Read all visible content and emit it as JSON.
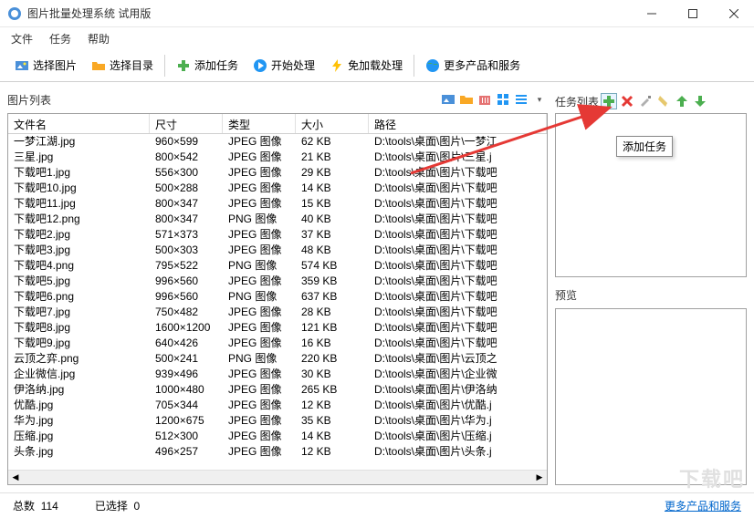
{
  "window": {
    "title": "图片批量处理系统 试用版"
  },
  "menu": {
    "file": "文件",
    "task": "任务",
    "help": "帮助"
  },
  "toolbar": {
    "select_image": "选择图片",
    "select_dir": "选择目录",
    "add_task": "添加任务",
    "start": "开始处理",
    "free_load": "免加载处理",
    "more": "更多产品和服务"
  },
  "left": {
    "title": "图片列表",
    "columns": {
      "name": "文件名",
      "dim": "尺寸",
      "type": "类型",
      "size": "大小",
      "path": "路径"
    },
    "rows": [
      {
        "name": "一梦江湖.jpg",
        "dim": "960×599",
        "type": "JPEG 图像",
        "size": "62 KB",
        "path": "D:\\tools\\桌面\\图片\\一梦江"
      },
      {
        "name": "三星.jpg",
        "dim": "800×542",
        "type": "JPEG 图像",
        "size": "21 KB",
        "path": "D:\\tools\\桌面\\图片\\三星.j"
      },
      {
        "name": "下载吧1.jpg",
        "dim": "556×300",
        "type": "JPEG 图像",
        "size": "29 KB",
        "path": "D:\\tools\\桌面\\图片\\下载吧"
      },
      {
        "name": "下载吧10.jpg",
        "dim": "500×288",
        "type": "JPEG 图像",
        "size": "14 KB",
        "path": "D:\\tools\\桌面\\图片\\下载吧"
      },
      {
        "name": "下载吧11.jpg",
        "dim": "800×347",
        "type": "JPEG 图像",
        "size": "15 KB",
        "path": "D:\\tools\\桌面\\图片\\下载吧"
      },
      {
        "name": "下载吧12.png",
        "dim": "800×347",
        "type": "PNG 图像",
        "size": "40 KB",
        "path": "D:\\tools\\桌面\\图片\\下载吧"
      },
      {
        "name": "下载吧2.jpg",
        "dim": "571×373",
        "type": "JPEG 图像",
        "size": "37 KB",
        "path": "D:\\tools\\桌面\\图片\\下载吧"
      },
      {
        "name": "下载吧3.jpg",
        "dim": "500×303",
        "type": "JPEG 图像",
        "size": "48 KB",
        "path": "D:\\tools\\桌面\\图片\\下载吧"
      },
      {
        "name": "下载吧4.png",
        "dim": "795×522",
        "type": "PNG 图像",
        "size": "574 KB",
        "path": "D:\\tools\\桌面\\图片\\下载吧"
      },
      {
        "name": "下载吧5.jpg",
        "dim": "996×560",
        "type": "JPEG 图像",
        "size": "359 KB",
        "path": "D:\\tools\\桌面\\图片\\下载吧"
      },
      {
        "name": "下载吧6.png",
        "dim": "996×560",
        "type": "PNG 图像",
        "size": "637 KB",
        "path": "D:\\tools\\桌面\\图片\\下载吧"
      },
      {
        "name": "下载吧7.jpg",
        "dim": "750×482",
        "type": "JPEG 图像",
        "size": "28 KB",
        "path": "D:\\tools\\桌面\\图片\\下载吧"
      },
      {
        "name": "下载吧8.jpg",
        "dim": "1600×1200",
        "type": "JPEG 图像",
        "size": "121 KB",
        "path": "D:\\tools\\桌面\\图片\\下载吧"
      },
      {
        "name": "下载吧9.jpg",
        "dim": "640×426",
        "type": "JPEG 图像",
        "size": "16 KB",
        "path": "D:\\tools\\桌面\\图片\\下载吧"
      },
      {
        "name": "云顶之弈.png",
        "dim": "500×241",
        "type": "PNG 图像",
        "size": "220 KB",
        "path": "D:\\tools\\桌面\\图片\\云顶之"
      },
      {
        "name": "企业微信.jpg",
        "dim": "939×496",
        "type": "JPEG 图像",
        "size": "30 KB",
        "path": "D:\\tools\\桌面\\图片\\企业微"
      },
      {
        "name": "伊洛纳.jpg",
        "dim": "1000×480",
        "type": "JPEG 图像",
        "size": "265 KB",
        "path": "D:\\tools\\桌面\\图片\\伊洛纳"
      },
      {
        "name": "优酷.jpg",
        "dim": "705×344",
        "type": "JPEG 图像",
        "size": "12 KB",
        "path": "D:\\tools\\桌面\\图片\\优酷.j"
      },
      {
        "name": "华为.jpg",
        "dim": "1200×675",
        "type": "JPEG 图像",
        "size": "35 KB",
        "path": "D:\\tools\\桌面\\图片\\华为.j"
      },
      {
        "name": "压缩.jpg",
        "dim": "512×300",
        "type": "JPEG 图像",
        "size": "14 KB",
        "path": "D:\\tools\\桌面\\图片\\压缩.j"
      },
      {
        "name": "头条.jpg",
        "dim": "496×257",
        "type": "JPEG 图像",
        "size": "12 KB",
        "path": "D:\\tools\\桌面\\图片\\头条.j"
      }
    ]
  },
  "right": {
    "task_title": "任务列表",
    "tooltip": "添加任务",
    "preview_title": "预览"
  },
  "status": {
    "total_label": "总数",
    "total_value": "114",
    "sel_label": "已选择",
    "sel_value": "0",
    "link": "更多产品和服务"
  },
  "watermark": "下载吧"
}
